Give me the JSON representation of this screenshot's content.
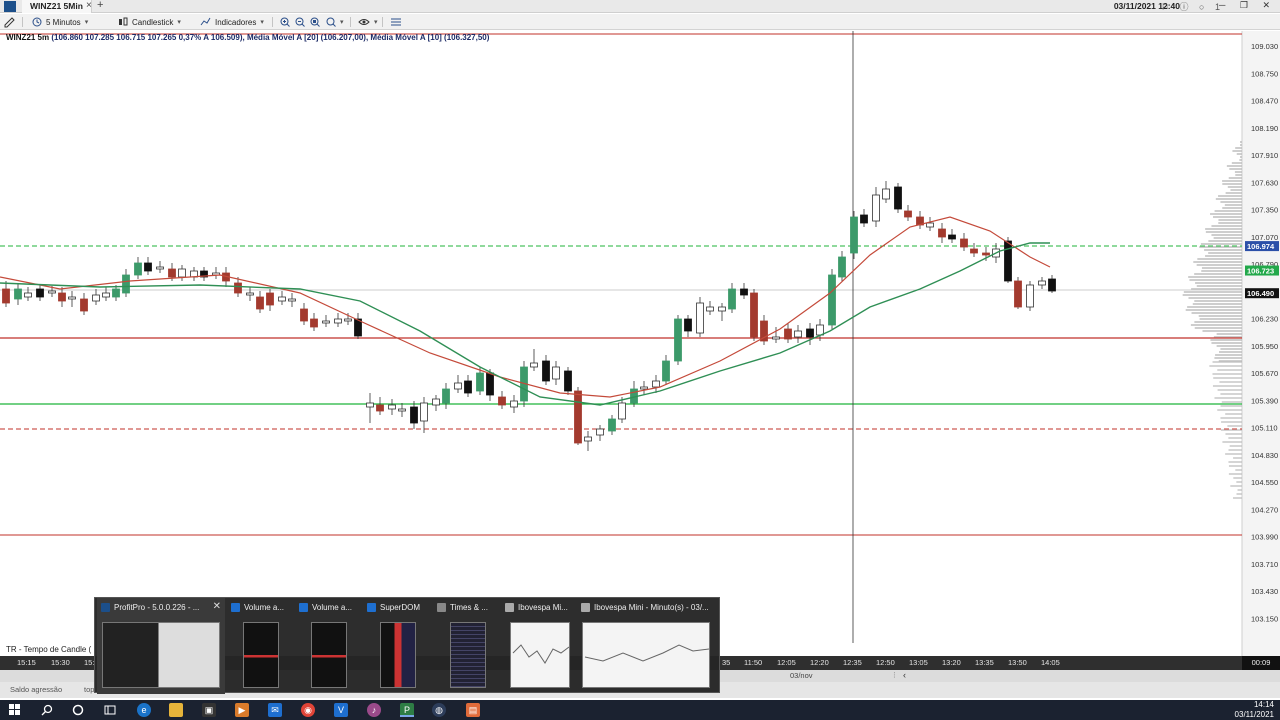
{
  "titlebar": {
    "tab_label": "WINZ21 5Min",
    "tab_close": "×",
    "tab_add": "+",
    "datetime": "03/11/2021 12:40",
    "small_icons": "⚐ ⓘ ○ 1",
    "window_buttons": "─ ❐ ✕"
  },
  "toolbar": {
    "interval": "5 Minutos",
    "chart_type": "Candlestick",
    "indicators": "Indicadores"
  },
  "chart": {
    "info": {
      "symbol": "WINZ21 5m",
      "ohlc": "(106.860  107.285  106.715  107.265  0,37%  A 106.509),",
      "ma20": "Média Móvel A [20] (106.207,00),",
      "ma10": "Média Móvel A [10] (106.327,50)"
    },
    "bottom_label": "TR - Tempo de Candle (",
    "price_labels": [
      "109.030",
      "108.750",
      "108.470",
      "108.190",
      "107.910",
      "107.630",
      "107.350",
      "107.070",
      "106.790",
      "106.510",
      "106.230",
      "105.950",
      "105.670",
      "105.390",
      "105.110",
      "104.830",
      "104.550",
      "104.270",
      "103.990",
      "103.710",
      "103.430",
      "103.150"
    ],
    "price_tags": [
      {
        "value": "106.974",
        "color": "#2b4fa8",
        "text_color": "#ffffff"
      },
      {
        "value": "106.723",
        "color": "#22a84a",
        "text_color": "#ffffff"
      },
      {
        "value": "106.490",
        "color": "#111111",
        "text_color": "#ffffff"
      }
    ],
    "colors": {
      "bull": "#3c9a6a",
      "bear": "#a33a2e",
      "black_candle": "#111111",
      "white_candle": "#ffffff",
      "ma_red": "#c44a3a",
      "ma_green": "#2f8f55",
      "line_red": "#c0312a",
      "line_green": "#1fb33a",
      "volume_profile": "#b9b9b9"
    }
  },
  "timeaxis": {
    "labels": [
      "15:15",
      "15:30",
      "15:",
      "35",
      "11:50",
      "12:05",
      "12:20",
      "12:35",
      "12:50",
      "13:05",
      "13:20",
      "13:35",
      "13:50",
      "14:05"
    ],
    "corner": "00:09"
  },
  "status": {
    "date": "03/nov",
    "left_label": "Saldo agressão",
    "left_label2": "top",
    "caret": "‹",
    "scroll_mark": "⁝"
  },
  "taskbar": {
    "time": "14:14",
    "date": "03/11/2021"
  },
  "task_preview": [
    {
      "title": "ProfitPro - 5.0.0.226 - ...",
      "icon_color": "#1c4f8a",
      "close": "✕"
    },
    {
      "title": "Volume a...",
      "icon_color": "#1e6fd0"
    },
    {
      "title": "Volume a...",
      "icon_color": "#1e6fd0"
    },
    {
      "title": "SuperDOM",
      "icon_color": "#1e6fd0"
    },
    {
      "title": "Times & ...",
      "icon_color": "#888888"
    },
    {
      "title": "Ibovespa Mi...",
      "icon_color": "#aaaaaa"
    },
    {
      "title": "Ibovespa Mini - Minuto(s) - 03/...",
      "icon_color": "#aaaaaa"
    }
  ]
}
